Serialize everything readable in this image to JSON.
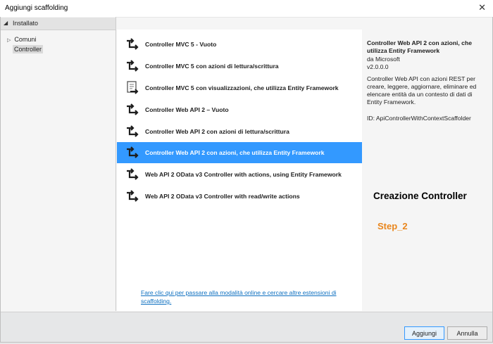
{
  "window": {
    "title": "Aggiungi scaffolding",
    "close_glyph": "✕"
  },
  "sidebar": {
    "header_label": "Installato",
    "items": [
      {
        "label": "Comuni",
        "expand_glyph": "▷"
      },
      {
        "label": "Controller",
        "selected": true
      }
    ]
  },
  "templates": {
    "items": [
      {
        "label": "Controller MVC 5 - Vuoto",
        "icon": "controller-arrows-icon"
      },
      {
        "label": "Controller MVC 5 con azioni di lettura/scrittura",
        "icon": "controller-arrows-icon"
      },
      {
        "label": "Controller MVC 5 con visualizzazioni, che utilizza Entity Framework",
        "icon": "controller-views-icon"
      },
      {
        "label": "Controller Web API 2 – Vuoto",
        "icon": "controller-arrows-icon"
      },
      {
        "label": "Controller Web API 2 con azioni di lettura/scrittura",
        "icon": "controller-arrows-icon"
      },
      {
        "label": "Controller Web API 2 con azioni, che utilizza Entity Framework",
        "icon": "controller-arrows-icon",
        "selected": true
      },
      {
        "label": "Web API 2 OData v3 Controller with actions, using Entity Framework",
        "icon": "controller-arrows-icon"
      },
      {
        "label": "Web API 2 OData v3 Controller with read/write actions",
        "icon": "controller-arrows-icon"
      }
    ],
    "online_link": "Fare clic qui per passare alla modalità online e cercare altre estensioni di scaffolding."
  },
  "details": {
    "title": "Controller Web API 2 con azioni, che utilizza Entity Framework",
    "author": "da Microsoft",
    "version": "v2.0.0.0",
    "description": "Controller Web API con azioni REST per creare, leggere, aggiornare, eliminare ed elencare entità da un contesto di dati di Entity Framework.",
    "id": "ID: ApiControllerWithContextScaffolder"
  },
  "annotation": {
    "title": "Creazione Controller",
    "step": "Step_2",
    "step_color": "#e9861d"
  },
  "footer": {
    "add_label": "Aggiungi",
    "cancel_label": "Annulla"
  },
  "colors": {
    "selection": "#3399ff",
    "link": "#0e70c0"
  }
}
